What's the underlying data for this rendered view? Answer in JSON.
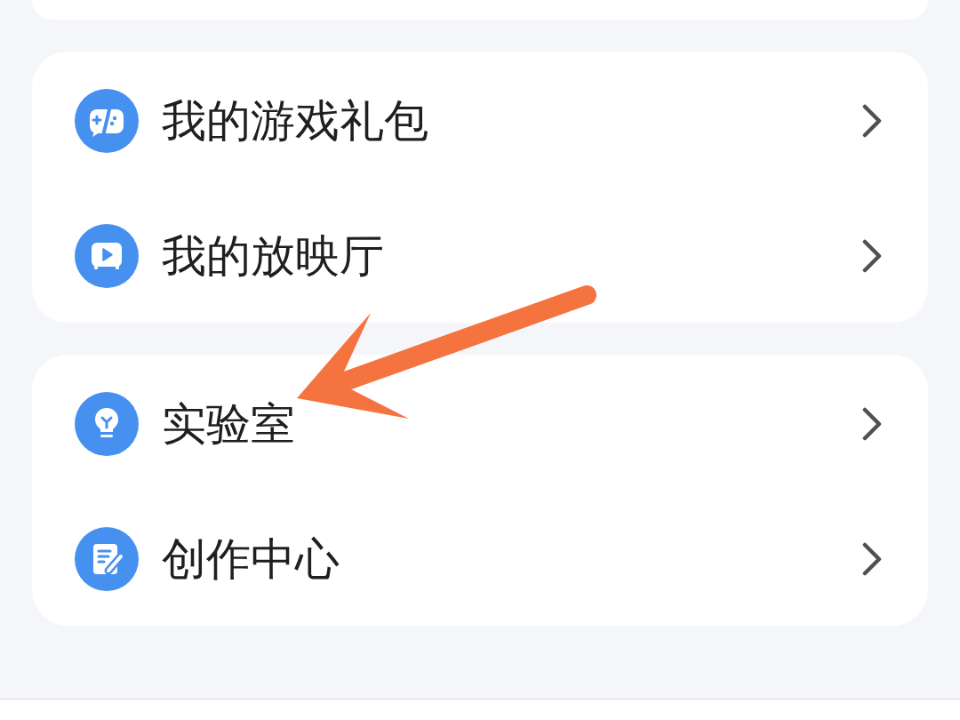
{
  "sections": [
    {
      "items": [
        {
          "label": "我的游戏礼包",
          "kind": "gamepad"
        },
        {
          "label": "我的放映厅",
          "kind": "screen"
        }
      ]
    },
    {
      "items": [
        {
          "label": "实验室",
          "kind": "bulb"
        },
        {
          "label": "创作中心",
          "kind": "edit"
        }
      ]
    }
  ],
  "annotations": [
    {
      "kind": "arrow"
    }
  ]
}
